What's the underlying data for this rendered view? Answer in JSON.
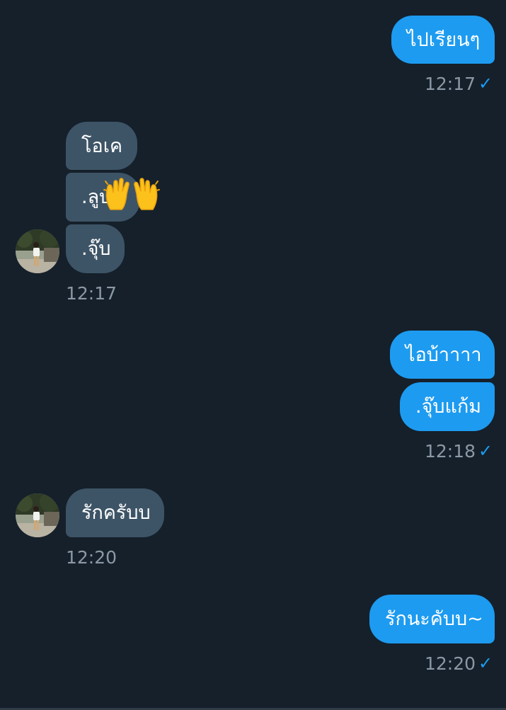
{
  "messages": {
    "m1": {
      "text": "ไปเรียนๆ"
    },
    "t1": "12:17",
    "m2": {
      "text": "โอเค"
    },
    "m3": {
      "text": ".ลูบ"
    },
    "m4": {
      "text": ".จุ๊บ"
    },
    "t2": "12:17",
    "m5": {
      "text": "ไอบ้าาาา"
    },
    "m6": {
      "text": ".จุ๊บแก้ม"
    },
    "t3": "12:18",
    "m7": {
      "text": "รักครับบ"
    },
    "t4": "12:20",
    "m8": {
      "text": "รักนะคับบ~"
    },
    "t5": "12:20"
  },
  "icons": {
    "sent": "check-icon",
    "emoji": "raising-hands-emoji"
  },
  "colors": {
    "background": "#15202b",
    "outgoing": "#1d9bf0",
    "incoming": "#3d5466",
    "timestamp": "#8b98a5"
  },
  "check_glyph": "✓"
}
